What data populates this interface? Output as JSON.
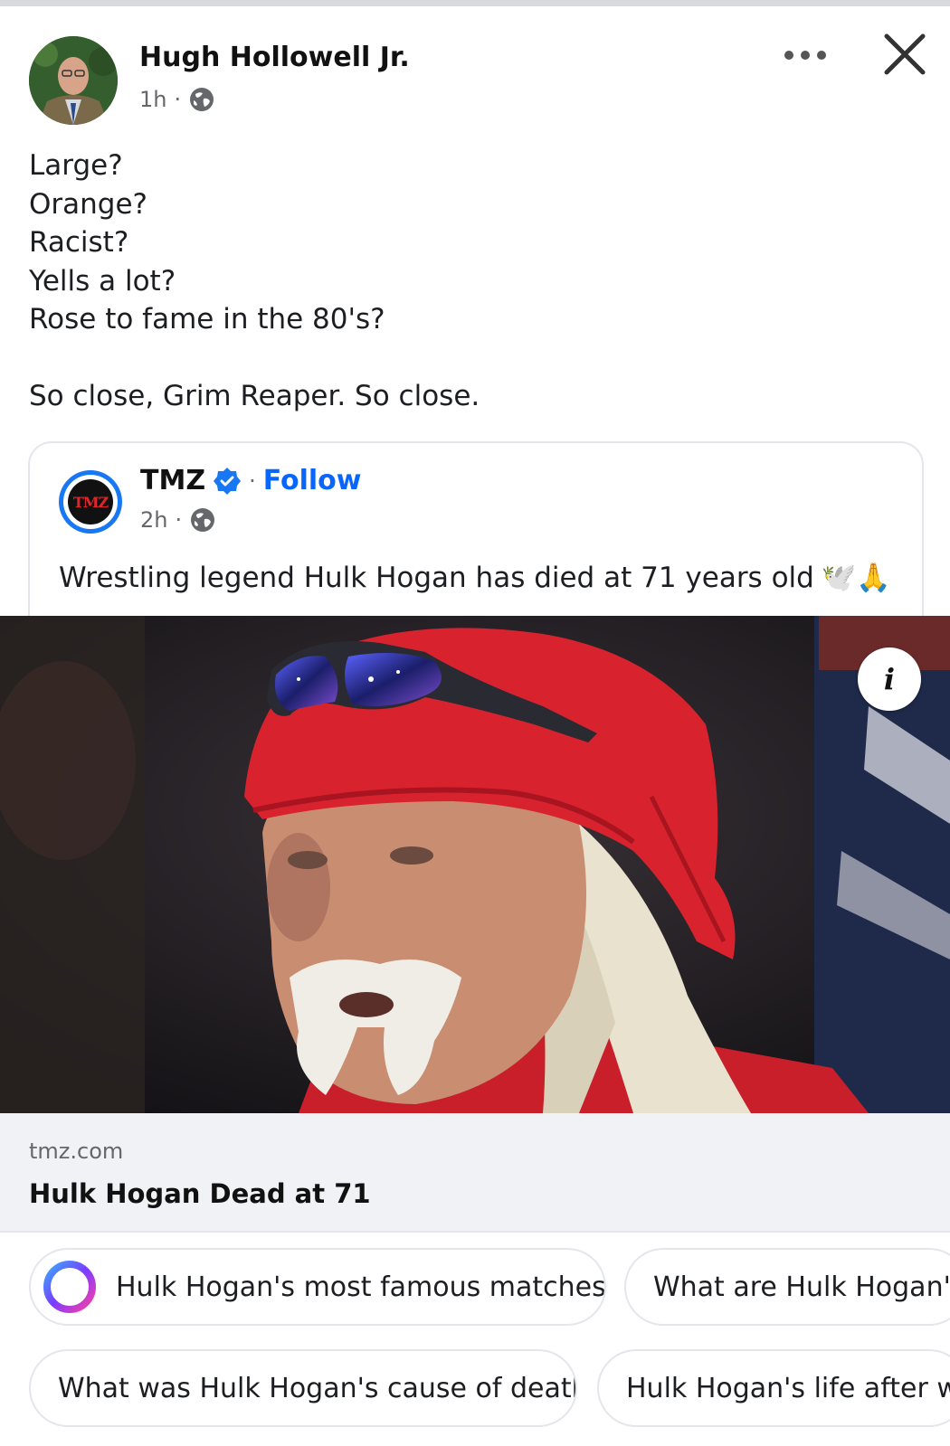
{
  "post": {
    "author": "Hugh Hollowell Jr.",
    "time": "1h",
    "separator": "·",
    "lines": [
      "Large?",
      "Orange?",
      "Racist?",
      "Yells a lot?",
      "Rose to fame in the 80's?",
      "",
      "So close, Grim Reaper. So close."
    ]
  },
  "shared": {
    "page_name": "TMZ",
    "logo_text": "TMZ",
    "separator": "·",
    "follow_label": "Follow",
    "time": "2h",
    "caption": "Wrestling legend Hulk Hogan has died at 71 years old",
    "caption_emojis": "🕊️🙏"
  },
  "link": {
    "domain": "tmz.com",
    "title": "Hulk Hogan Dead at 71"
  },
  "suggestions": [
    "Hulk Hogan's most famous matches?",
    "What are Hulk Hogan's g",
    "What was Hulk Hogan's cause of death?",
    "Hulk Hogan's life after wre"
  ],
  "icons": {
    "more": "more-dots-icon",
    "close": "close-icon",
    "privacy": "globe-icon",
    "verified": "verified-badge-icon",
    "info": "info-icon",
    "ai": "meta-ai-icon"
  },
  "colors": {
    "link_blue": "#0866ff",
    "verified_blue": "#1877f2",
    "muted": "#65676b",
    "bandana_red": "#d8232f"
  }
}
